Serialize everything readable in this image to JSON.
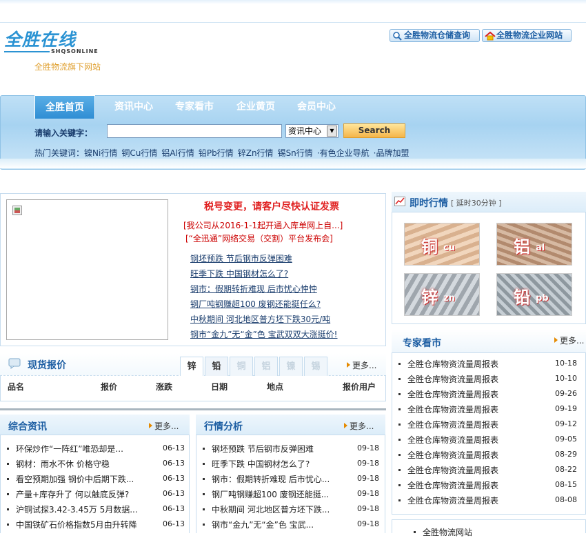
{
  "header": {
    "logo_text": "全胜在线",
    "logo_subtext": "SHQSONLINE",
    "subtitle": "全胜物流旗下网站",
    "top_buttons": [
      "全胜物流仓储查询",
      "全胜物流企业网站"
    ]
  },
  "nav": {
    "tabs": [
      "全胜首页",
      "资讯中心",
      "专家看市",
      "企业黄页",
      "会员中心"
    ]
  },
  "search": {
    "label": "请输入关键字：",
    "input_value": "",
    "select_value": "资讯中心",
    "button": "Search"
  },
  "hot": {
    "label": "热门关键词：",
    "items": [
      "镍Ni行情",
      "铜Cu行情",
      "铝Al行情",
      "铅Pb行情",
      "锌Zn行情",
      "锡Sn行情",
      "·有色企业导航",
      "·品牌加盟"
    ]
  },
  "news_center": {
    "headline": "税号变更，请客户尽快认证发票",
    "notices": [
      "[我公司从2016-1-1起开通入库单网上自...]",
      "[“全迅通”网络交易（交割）平台发布会]"
    ],
    "links": [
      "钢坯预跌 节后钢市反弹困难",
      "旺季下跌 中国钢材怎么了?",
      "钢市：假期转折难现 后市忧心忡忡",
      "钢厂吨钢赚超100 废钢还能挺任么?",
      "中秋期间 河北地区普方坯下跌30元/吨",
      "钢市“金九”无“金”色 宝武双双大涨挺价!"
    ]
  },
  "quote_panel": {
    "title": "即时行情",
    "delay_note": "[ 延时30分钟 ]",
    "metals": [
      {
        "cn": "铜",
        "en": "cu"
      },
      {
        "cn": "铝",
        "en": "al"
      },
      {
        "cn": "锌",
        "en": "zn"
      },
      {
        "cn": "铅",
        "en": "pb"
      }
    ]
  },
  "spot_price": {
    "title": "现货报价",
    "tabs": [
      "锌",
      "铅",
      "铜",
      "铝",
      "镍",
      "锡"
    ],
    "more": "更多...",
    "columns": [
      "品名",
      "报价",
      "涨跌",
      "日期",
      "地点",
      "报价用户"
    ]
  },
  "expert": {
    "title": "专家看市",
    "more": "更多...",
    "items": [
      {
        "title": "全胜仓库物资流量周报表",
        "date": "10-18"
      },
      {
        "title": "全胜仓库物资流量周报表",
        "date": "10-10"
      },
      {
        "title": "全胜仓库物资流量周报表",
        "date": "09-26"
      },
      {
        "title": "全胜仓库物资流量周报表",
        "date": "09-19"
      },
      {
        "title": "全胜仓库物资流量周报表",
        "date": "09-12"
      },
      {
        "title": "全胜仓库物资流量周报表",
        "date": "09-05"
      },
      {
        "title": "全胜仓库物资流量周报表",
        "date": "08-29"
      },
      {
        "title": "全胜仓库物资流量周报表",
        "date": "08-22"
      },
      {
        "title": "全胜仓库物资流量周报表",
        "date": "08-15"
      },
      {
        "title": "全胜仓库物资流量周报表",
        "date": "08-08"
      }
    ],
    "footer_link": "全胜物流网站"
  },
  "general_news": {
    "title": "综合资讯",
    "more": "更多...",
    "items": [
      {
        "title": "环保炒作“一阵红”唯恐却是...",
        "date": "06-13"
      },
      {
        "title": "钢材：雨水不休 价格守稳",
        "date": "06-13"
      },
      {
        "title": "看空预期加强 钢价中后期下跌...",
        "date": "06-13"
      },
      {
        "title": "产量+库存升了 何以触底反弹?",
        "date": "06-13"
      },
      {
        "title": "沪铜试探3.42-3.45万 5月数据...",
        "date": "06-13"
      },
      {
        "title": "中国铁矿石价格指数5月由升转降",
        "date": "06-13"
      }
    ]
  },
  "market_analysis": {
    "title": "行情分析",
    "more": "更多...",
    "items": [
      {
        "title": "钢坯预跌 节后钢市反弹困难",
        "date": "09-18"
      },
      {
        "title": "旺季下跌 中国钢材怎么了?",
        "date": "09-18"
      },
      {
        "title": "钢市：假期转折难现 后市忧心...",
        "date": "09-18"
      },
      {
        "title": "钢厂吨钢赚超100 废钢还能挺...",
        "date": "09-18"
      },
      {
        "title": "中秋期间 河北地区普方坯下跌...",
        "date": "09-18"
      },
      {
        "title": "钢市“金九”无“金”色 宝武...",
        "date": "09-18"
      }
    ]
  },
  "colors": {
    "brand": "#2b93d3",
    "nav_bg": "#a7d3f1",
    "headline_red": "#e02020",
    "link_blue": "#1a3d6d"
  }
}
